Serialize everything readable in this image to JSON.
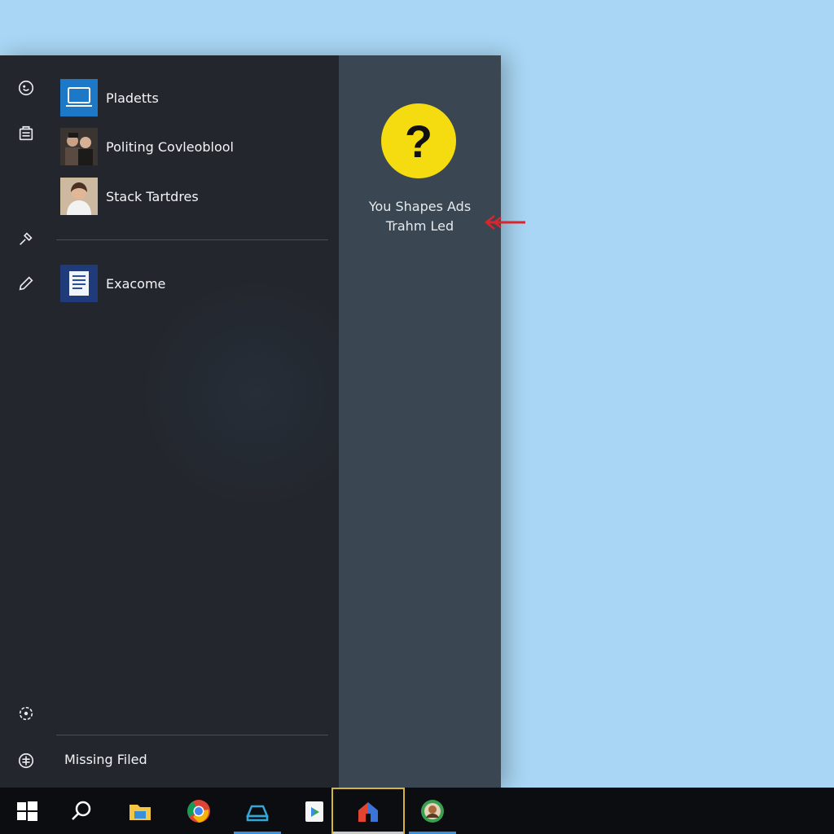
{
  "start_menu": {
    "rail_icons": [
      "account-icon",
      "documents-icon",
      "tools-icon",
      "edit-icon",
      "settings-icon",
      "power-icon"
    ],
    "apps": [
      {
        "label": "Pladetts",
        "icon": "monitor-app-icon"
      },
      {
        "label": "Politing Covleoblool",
        "icon": "photo-thumbnail-icon"
      },
      {
        "label": "Stack Tartdres",
        "icon": "portrait-thumbnail-icon"
      },
      {
        "label": "Exacome",
        "icon": "document-app-icon"
      }
    ],
    "missing_label": "Missing Filed"
  },
  "side_panel": {
    "help_symbol": "?",
    "line1": "You Shapes Ads",
    "line2": "Trahm Led"
  },
  "taskbar": {
    "items": [
      "windows-start-icon",
      "search-icon",
      "file-explorer-icon",
      "chrome-icon",
      "inbox-icon",
      "play-store-icon",
      "home-app-icon",
      "avatar-app-icon"
    ],
    "active": "home-app-icon"
  },
  "colors": {
    "desktop": "#a8d6f4",
    "menu_bg": "#23262c",
    "panel_bg": "#3a4651",
    "help_yellow": "#f5dc10",
    "arrow_red": "#d8262c",
    "taskbar_bg": "#0b0d10",
    "accent": "#3a8fd9"
  }
}
